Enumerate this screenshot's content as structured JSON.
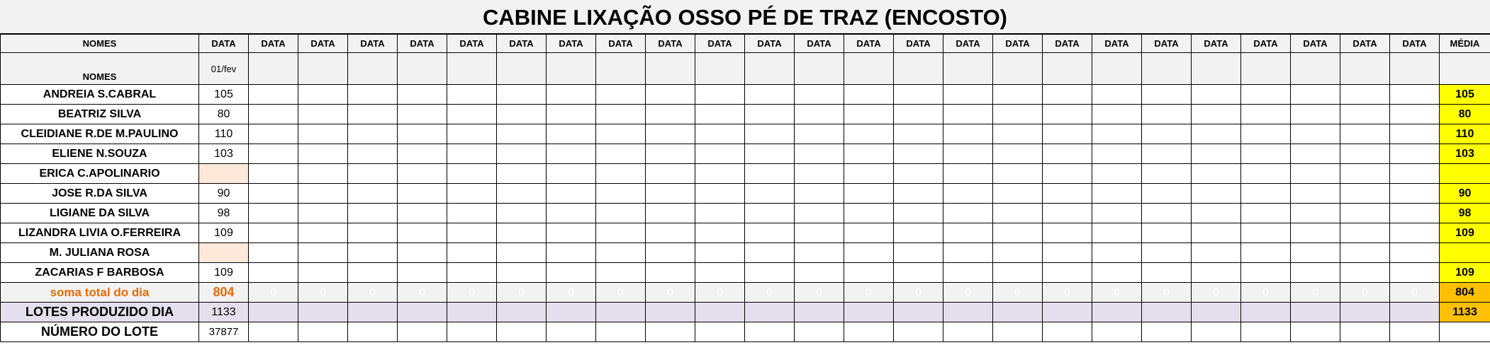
{
  "title": "CABINE LIXAÇÃO OSSO PÉ DE TRAZ (ENCOSTO)",
  "header": {
    "names_label": "NOMES",
    "date_label": "DATA",
    "date_count": 25,
    "media_label": "MÉDIA"
  },
  "subheader": {
    "names_label": "NOMES",
    "first_date": "01/fev"
  },
  "employees": [
    {
      "name": "ANDREIA S.CABRAL",
      "value": "105",
      "avg": "105"
    },
    {
      "name": "BEATRIZ SILVA",
      "value": "80",
      "avg": "80"
    },
    {
      "name": "CLEIDIANE R.DE M.PAULINO",
      "value": "110",
      "avg": "110"
    },
    {
      "name": "ELIENE N.SOUZA",
      "value": "103",
      "avg": "103"
    },
    {
      "name": "ERICA C.APOLINARIO",
      "value": "",
      "avg": ""
    },
    {
      "name": "JOSE R.DA SILVA",
      "value": "90",
      "avg": "90"
    },
    {
      "name": "LIGIANE DA SILVA",
      "value": "98",
      "avg": "98"
    },
    {
      "name": "LIZANDRA LIVIA O.FERREIRA",
      "value": "109",
      "avg": "109"
    },
    {
      "name": "M. JULIANA ROSA",
      "value": "",
      "avg": ""
    },
    {
      "name": "ZACARIAS F BARBOSA",
      "value": "109",
      "avg": "109"
    }
  ],
  "sum_row": {
    "label": "soma total  do dia",
    "first": "804",
    "other": "0",
    "avg": "804"
  },
  "lotes_row": {
    "label": "LOTES PRODUZIDO DIA",
    "first": "1133",
    "avg": "1133"
  },
  "lote_row": {
    "label": "NÚMERO DO LOTE",
    "first": "37877"
  },
  "colors": {
    "header_bg": "#f2f2f2",
    "avg_yellow": "#ffff00",
    "avg_orange": "#ffc000",
    "sum_label": "#e46c0a",
    "lotes_bg": "#e4dfec",
    "empty_cell": "#fde9d9"
  }
}
